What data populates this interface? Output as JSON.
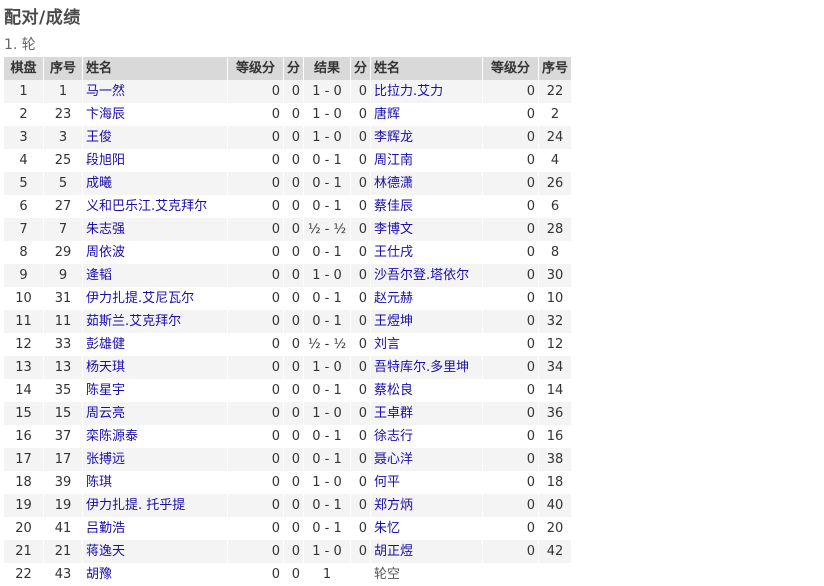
{
  "page_title": "配对/成绩",
  "round_title": "1. 轮",
  "headers": {
    "board": "棋盘",
    "white_no": "序号",
    "white_name": "姓名",
    "white_rating": "等级分",
    "white_pts": "分",
    "result": "结果",
    "black_pts": "分",
    "black_name": "姓名",
    "black_rating": "等级分",
    "black_no": "序号"
  },
  "rows": [
    {
      "board": "1",
      "wno": "1",
      "wname": "马一然",
      "wrating": "0",
      "wpts": "0",
      "result": "1 - 0",
      "bpts": "0",
      "bname": "比拉力.艾力",
      "brating": "0",
      "bno": "22"
    },
    {
      "board": "2",
      "wno": "23",
      "wname": "卞海辰",
      "wrating": "0",
      "wpts": "0",
      "result": "1 - 0",
      "bpts": "0",
      "bname": "唐辉",
      "brating": "0",
      "bno": "2"
    },
    {
      "board": "3",
      "wno": "3",
      "wname": "王俊",
      "wrating": "0",
      "wpts": "0",
      "result": "1 - 0",
      "bpts": "0",
      "bname": "李辉龙",
      "brating": "0",
      "bno": "24"
    },
    {
      "board": "4",
      "wno": "25",
      "wname": "段旭阳",
      "wrating": "0",
      "wpts": "0",
      "result": "0 - 1",
      "bpts": "0",
      "bname": "周江南",
      "brating": "0",
      "bno": "4"
    },
    {
      "board": "5",
      "wno": "5",
      "wname": "成曦",
      "wrating": "0",
      "wpts": "0",
      "result": "0 - 1",
      "bpts": "0",
      "bname": "林德潇",
      "brating": "0",
      "bno": "26"
    },
    {
      "board": "6",
      "wno": "27",
      "wname": "义和巴乐江.艾克拜尔",
      "wrating": "0",
      "wpts": "0",
      "result": "0 - 1",
      "bpts": "0",
      "bname": "蔡佳辰",
      "brating": "0",
      "bno": "6"
    },
    {
      "board": "7",
      "wno": "7",
      "wname": "朱志强",
      "wrating": "0",
      "wpts": "0",
      "result": "½ - ½",
      "bpts": "0",
      "bname": "李博文",
      "brating": "0",
      "bno": "28"
    },
    {
      "board": "8",
      "wno": "29",
      "wname": "周依波",
      "wrating": "0",
      "wpts": "0",
      "result": "0 - 1",
      "bpts": "0",
      "bname": "王仕戌",
      "brating": "0",
      "bno": "8"
    },
    {
      "board": "9",
      "wno": "9",
      "wname": "逄韬",
      "wrating": "0",
      "wpts": "0",
      "result": "1 - 0",
      "bpts": "0",
      "bname": "沙吾尔登.塔依尔",
      "brating": "0",
      "bno": "30"
    },
    {
      "board": "10",
      "wno": "31",
      "wname": "伊力扎提.艾尼瓦尔",
      "wrating": "0",
      "wpts": "0",
      "result": "0 - 1",
      "bpts": "0",
      "bname": "赵元赫",
      "brating": "0",
      "bno": "10"
    },
    {
      "board": "11",
      "wno": "11",
      "wname": "茹斯兰.艾克拜尔",
      "wrating": "0",
      "wpts": "0",
      "result": "0 - 1",
      "bpts": "0",
      "bname": "王煜坤",
      "brating": "0",
      "bno": "32"
    },
    {
      "board": "12",
      "wno": "33",
      "wname": "彭雄健",
      "wrating": "0",
      "wpts": "0",
      "result": "½ - ½",
      "bpts": "0",
      "bname": "刘言",
      "brating": "0",
      "bno": "12"
    },
    {
      "board": "13",
      "wno": "13",
      "wname": "杨天琪",
      "wrating": "0",
      "wpts": "0",
      "result": "1 - 0",
      "bpts": "0",
      "bname": "吾特库尔.多里坤",
      "brating": "0",
      "bno": "34"
    },
    {
      "board": "14",
      "wno": "35",
      "wname": "陈星宇",
      "wrating": "0",
      "wpts": "0",
      "result": "0 - 1",
      "bpts": "0",
      "bname": "蔡松良",
      "brating": "0",
      "bno": "14"
    },
    {
      "board": "15",
      "wno": "15",
      "wname": "周云亮",
      "wrating": "0",
      "wpts": "0",
      "result": "1 - 0",
      "bpts": "0",
      "bname": "王卓群",
      "brating": "0",
      "bno": "36"
    },
    {
      "board": "16",
      "wno": "37",
      "wname": "栾陈源泰",
      "wrating": "0",
      "wpts": "0",
      "result": "0 - 1",
      "bpts": "0",
      "bname": "徐志行",
      "brating": "0",
      "bno": "16"
    },
    {
      "board": "17",
      "wno": "17",
      "wname": "张搏远",
      "wrating": "0",
      "wpts": "0",
      "result": "0 - 1",
      "bpts": "0",
      "bname": "聂心洋",
      "brating": "0",
      "bno": "38"
    },
    {
      "board": "18",
      "wno": "39",
      "wname": "陈琪",
      "wrating": "0",
      "wpts": "0",
      "result": "1 - 0",
      "bpts": "0",
      "bname": "何平",
      "brating": "0",
      "bno": "18"
    },
    {
      "board": "19",
      "wno": "19",
      "wname": "伊力扎提. 托乎提",
      "wrating": "0",
      "wpts": "0",
      "result": "0 - 1",
      "bpts": "0",
      "bname": "郑方炳",
      "brating": "0",
      "bno": "40"
    },
    {
      "board": "20",
      "wno": "41",
      "wname": "吕勤浩",
      "wrating": "0",
      "wpts": "0",
      "result": "0 - 1",
      "bpts": "0",
      "bname": "朱忆",
      "brating": "0",
      "bno": "20"
    },
    {
      "board": "21",
      "wno": "21",
      "wname": "蒋逸天",
      "wrating": "0",
      "wpts": "0",
      "result": "1 - 0",
      "bpts": "0",
      "bname": "胡正煜",
      "brating": "0",
      "bno": "42"
    },
    {
      "board": "22",
      "wno": "43",
      "wname": "胡豫",
      "wrating": "0",
      "wpts": "0",
      "result": "1",
      "bpts": "",
      "bname": "轮空",
      "brating": "",
      "bno": "",
      "bye": true
    }
  ]
}
